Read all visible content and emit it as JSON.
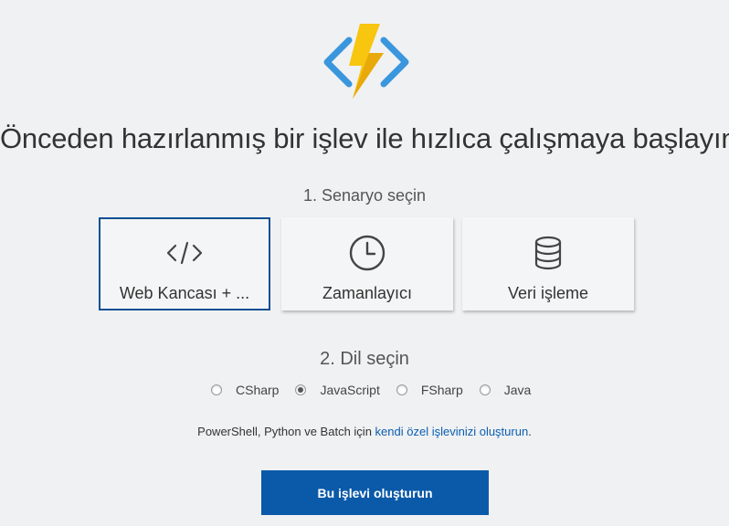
{
  "header": {
    "logo_icon": "azure-functions-logo",
    "title": "Önceden hazırlanmış bir işlev ile hızlıca çalışmaya başlayın"
  },
  "scenario": {
    "heading": "1. Senaryo seçin",
    "tiles": [
      {
        "label": "Web Kancası + ...",
        "icon": "code-icon",
        "selected": true
      },
      {
        "label": "Zamanlayıcı",
        "icon": "clock-icon",
        "selected": false
      },
      {
        "label": "Veri işleme",
        "icon": "database-icon",
        "selected": false
      }
    ]
  },
  "language": {
    "heading": "2. Dil seçin",
    "options": [
      {
        "label": "CSharp",
        "checked": false
      },
      {
        "label": "JavaScript",
        "checked": true
      },
      {
        "label": "FSharp",
        "checked": false
      },
      {
        "label": "Java",
        "checked": false
      }
    ]
  },
  "note": {
    "prefix": "PowerShell, Python ve Batch için ",
    "link": "kendi özel işlevinizi oluşturun",
    "suffix": "."
  },
  "actions": {
    "create_label": "Bu işlevi oluşturun"
  },
  "colors": {
    "accent": "#0b5aa9",
    "selected_border": "#0d4f92",
    "link": "#0b5eb0",
    "logo_bolt": "#f8c50f",
    "logo_brackets": "#3a96dd"
  }
}
